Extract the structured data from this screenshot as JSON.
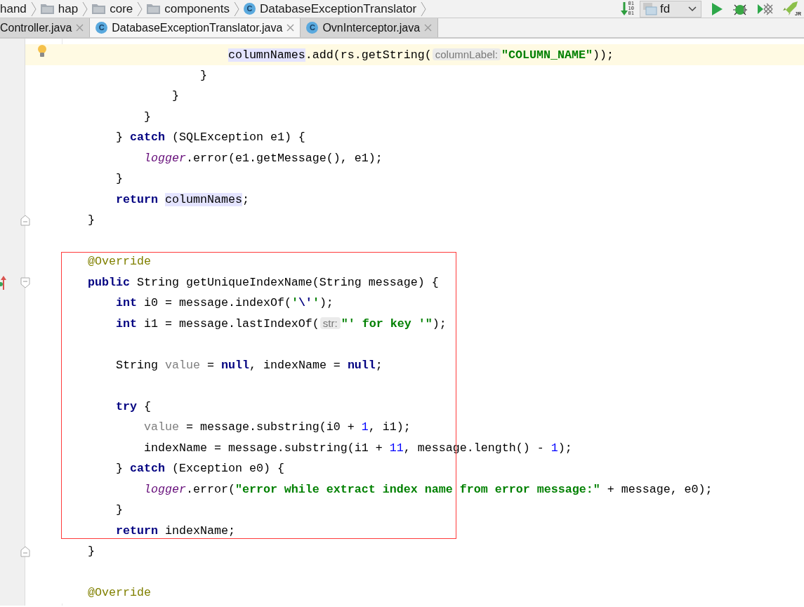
{
  "breadcrumbs": [
    {
      "label": "hand",
      "kind": "text"
    },
    {
      "label": "hap",
      "kind": "folder"
    },
    {
      "label": "core",
      "kind": "folder"
    },
    {
      "label": "components",
      "kind": "folder"
    },
    {
      "label": "DatabaseExceptionTranslator",
      "kind": "class",
      "icon_letter": "C"
    }
  ],
  "toolbar": {
    "binary_digits": [
      "01",
      "10",
      "01"
    ],
    "run_config": "fd",
    "tools": [
      {
        "kind": "run"
      },
      {
        "kind": "debug"
      },
      {
        "kind": "coverage"
      },
      {
        "kind": "rocket",
        "badge": "JR"
      }
    ]
  },
  "tabs": [
    {
      "label": "Controller.java",
      "selected": false
    },
    {
      "label": "DatabaseExceptionTranslator.java",
      "icon_letter": "C",
      "selected": true
    },
    {
      "label": "OvnInterceptor.java",
      "icon_letter": "C",
      "selected": false
    }
  ],
  "editor": {
    "lines": [
      {
        "current": true,
        "gutter": {
          "kind": "bulb"
        },
        "tokens": [
          {
            "kind": "ref",
            "text": "                        columnNames"
          },
          {
            "kind": "plain",
            "text": ".add(rs.getString("
          },
          {
            "kind": "hint",
            "text": "columnLabel:"
          },
          {
            "kind": "str",
            "text": "\"COLUMN_NAME\""
          },
          {
            "kind": "plain",
            "text": "));"
          }
        ]
      },
      {
        "current": false,
        "tokens": [
          {
            "kind": "plain",
            "text": "                    }"
          }
        ]
      },
      {
        "current": false,
        "tokens": [
          {
            "kind": "plain",
            "text": "                }"
          }
        ]
      },
      {
        "current": false,
        "tokens": [
          {
            "kind": "plain",
            "text": "            }"
          }
        ]
      },
      {
        "current": false,
        "tokens": [
          {
            "kind": "plain",
            "text": "        } "
          },
          {
            "kind": "kw",
            "text": "catch"
          },
          {
            "kind": "plain",
            "text": " (SQLException e1) {"
          }
        ]
      },
      {
        "current": false,
        "tokens": [
          {
            "kind": "field",
            "text": "            logger"
          },
          {
            "kind": "plain",
            "text": ".error(e1.getMessage(), e1);"
          }
        ]
      },
      {
        "current": false,
        "tokens": [
          {
            "kind": "plain",
            "text": "        }"
          }
        ]
      },
      {
        "current": false,
        "tokens": [
          {
            "kind": "kw",
            "text": "        return "
          },
          {
            "kind": "ref",
            "text": "columnNames"
          },
          {
            "kind": "plain",
            "text": ";"
          }
        ]
      },
      {
        "current": false,
        "gutter": {
          "kind": "fold-end"
        },
        "tokens": [
          {
            "kind": "plain",
            "text": "    }"
          }
        ]
      },
      {
        "current": false
      },
      {
        "current": false,
        "tokens": [
          {
            "kind": "ann",
            "text": "    @Override"
          }
        ]
      },
      {
        "current": false,
        "gutter": {
          "kind": "override"
        },
        "tokens": [
          {
            "kind": "kw",
            "text": "    public"
          },
          {
            "kind": "plain",
            "text": " String getUniqueIndexName(String message) {"
          }
        ]
      },
      {
        "current": false,
        "tokens": [
          {
            "kind": "kw",
            "text": "        int"
          },
          {
            "kind": "plain",
            "text": " i0 = message.indexOf("
          },
          {
            "kind": "str",
            "text": "'"
          },
          {
            "kind": "esc",
            "text": "\\'"
          },
          {
            "kind": "str",
            "text": "'"
          },
          {
            "kind": "plain",
            "text": ");"
          }
        ]
      },
      {
        "current": false,
        "tokens": [
          {
            "kind": "kw",
            "text": "        int"
          },
          {
            "kind": "plain",
            "text": " i1 = message.lastIndexOf("
          },
          {
            "kind": "hint",
            "text": "str:"
          },
          {
            "kind": "str",
            "text": "\"' for key '\""
          },
          {
            "kind": "plain",
            "text": ");"
          }
        ]
      },
      {
        "current": false
      },
      {
        "current": false,
        "tokens": [
          {
            "kind": "plain",
            "text": "        String "
          },
          {
            "kind": "unused",
            "text": "value"
          },
          {
            "kind": "plain",
            "text": " = "
          },
          {
            "kind": "kw",
            "text": "null"
          },
          {
            "kind": "plain",
            "text": ", indexName = "
          },
          {
            "kind": "kw",
            "text": "null"
          },
          {
            "kind": "plain",
            "text": ";"
          }
        ]
      },
      {
        "current": false
      },
      {
        "current": false,
        "tokens": [
          {
            "kind": "kw",
            "text": "        try"
          },
          {
            "kind": "plain",
            "text": " {"
          }
        ]
      },
      {
        "current": false,
        "tokens": [
          {
            "kind": "unused",
            "text": "            value"
          },
          {
            "kind": "plain",
            "text": " = message.substring(i0 + "
          },
          {
            "kind": "num",
            "text": "1"
          },
          {
            "kind": "plain",
            "text": ", i1);"
          }
        ]
      },
      {
        "current": false,
        "tokens": [
          {
            "kind": "plain",
            "text": "            indexName = message.substring(i1 + "
          },
          {
            "kind": "num",
            "text": "11"
          },
          {
            "kind": "plain",
            "text": ", message.length() - "
          },
          {
            "kind": "num",
            "text": "1"
          },
          {
            "kind": "plain",
            "text": ");"
          }
        ]
      },
      {
        "current": false,
        "tokens": [
          {
            "kind": "plain",
            "text": "        } "
          },
          {
            "kind": "kw",
            "text": "catch"
          },
          {
            "kind": "plain",
            "text": " (Exception e0) {"
          }
        ]
      },
      {
        "current": false,
        "tokens": [
          {
            "kind": "field",
            "text": "            logger"
          },
          {
            "kind": "plain",
            "text": ".error("
          },
          {
            "kind": "str",
            "text": "\"error while extract index name from error message:\""
          },
          {
            "kind": "plain",
            "text": " + message, e0);"
          }
        ]
      },
      {
        "current": false,
        "tokens": [
          {
            "kind": "plain",
            "text": "        }"
          }
        ]
      },
      {
        "current": false,
        "tokens": [
          {
            "kind": "kw",
            "text": "        return"
          },
          {
            "kind": "plain",
            "text": " indexName;"
          }
        ]
      },
      {
        "current": false,
        "gutter": {
          "kind": "fold-end"
        },
        "tokens": [
          {
            "kind": "plain",
            "text": "    }"
          }
        ]
      },
      {
        "current": false
      },
      {
        "current": false,
        "tokens": [
          {
            "kind": "ann",
            "text": "    @Override"
          }
        ]
      }
    ]
  }
}
